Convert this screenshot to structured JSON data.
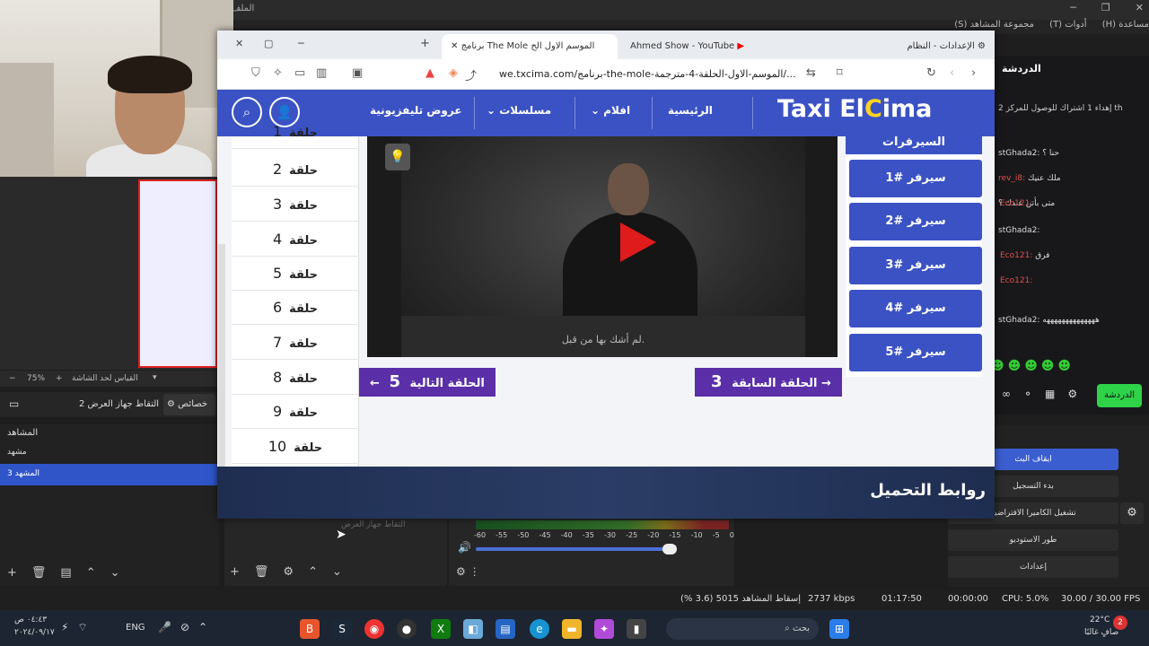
{
  "obs": {
    "window_title": "الملف",
    "menu": [
      "مساعدة (H)",
      "أدوات (T)",
      "مجموعة المشاهد (S)"
    ],
    "zoom_label": "75%",
    "zoom_note": "القياس لحد الشاشة",
    "source_name": "التقاط جهاز العرض 2",
    "properties_label": "خصائص",
    "scenes_title": "المشاهد",
    "scenes": [
      {
        "label": "مشهد",
        "selected": false
      },
      {
        "label": "المشهد 3",
        "selected": true
      }
    ],
    "source_list_item": "التقاط جهاز العرض",
    "mixer_scale": [
      "-60",
      "-55",
      "-50",
      "-45",
      "-40",
      "-35",
      "-30",
      "-25",
      "-20",
      "-15",
      "-10",
      "-5",
      "0"
    ],
    "controls": {
      "stop_stream": "ايقاف البث",
      "start_recording": "بدء التسجيل",
      "virtual_camera": "تشغيل الكاميرا الافتراضية",
      "studio_mode": "طور الاستوديو",
      "settings": "إعدادات"
    },
    "status": {
      "fps": "30.00 / 30.00 FPS",
      "cpu": "CPU: 5.0%",
      "rec_time": "00:00:00",
      "stream_time": "01:17:50",
      "bitrate": "2737 kbps",
      "dropped": "إسقاط المشاهد 5015 (3.6 %)"
    }
  },
  "chat": {
    "title": "الدردشة",
    "top_note": "إهداء 1 اشتراك للوصول للمركز 2 th",
    "lines": [
      {
        "name": "stGhada2:",
        "text": "حنا ؟"
      },
      {
        "name": "rev_i8:",
        "text": "ملك عنيك"
      },
      {
        "name": "",
        "text": "متى بأتن عندك ؟"
      },
      {
        "name": "Eco121:",
        "text": ""
      },
      {
        "name": "stGhada2:",
        "text": ""
      },
      {
        "name": "Eco121:",
        "text": "فرق"
      },
      {
        "name": "Eco121:",
        "text": ""
      },
      {
        "name": "stGhada2:",
        "text": "ههههههههههههههه"
      }
    ],
    "chat_button": "الدردشة"
  },
  "browser": {
    "tabs": [
      {
        "label": "برنامج The Mole الموسم الاول الح",
        "active": true
      },
      {
        "label": "Ahmed Show - YouTube",
        "active": false
      },
      {
        "label": "الإعدادات - النظام",
        "active": false
      }
    ],
    "url": "we.txcima.com/برنامج-the-mole-الموسم-الاول-الحلقة-4-مترجمة/..."
  },
  "site": {
    "logo_left": "Taxi El",
    "logo_c": "C",
    "logo_right": "ima",
    "nav": [
      "الرئيسية",
      "افلام",
      "مسلسلات",
      "عروض تليفزيونية"
    ],
    "episode_word": "حلقة",
    "episodes": [
      "1",
      "2",
      "3",
      "4",
      "5",
      "6",
      "7",
      "8",
      "9",
      "10"
    ],
    "video_subtitle": "لم أشك بها من قبل.",
    "servers_title": "السيرفرات",
    "servers": [
      "سيرفر #1",
      "سيرفر #2",
      "سيرفر #3",
      "سيرفر #4",
      "سيرفر #5"
    ],
    "next_episode": "الحلقة التالية",
    "next_num": "5",
    "prev_episode": "الحلقة السابقة",
    "prev_num": "3",
    "downloads_title": "روابط التحميل"
  },
  "taskbar": {
    "search_placeholder": "بحث",
    "lang": "ENG",
    "time": "٠٤:٤٣ ص",
    "date": "٢٠٢٤/٠٩/١٧",
    "weather_temp": "22°C",
    "weather_desc": "صافٍ غالبًا",
    "notif_count": "2"
  }
}
